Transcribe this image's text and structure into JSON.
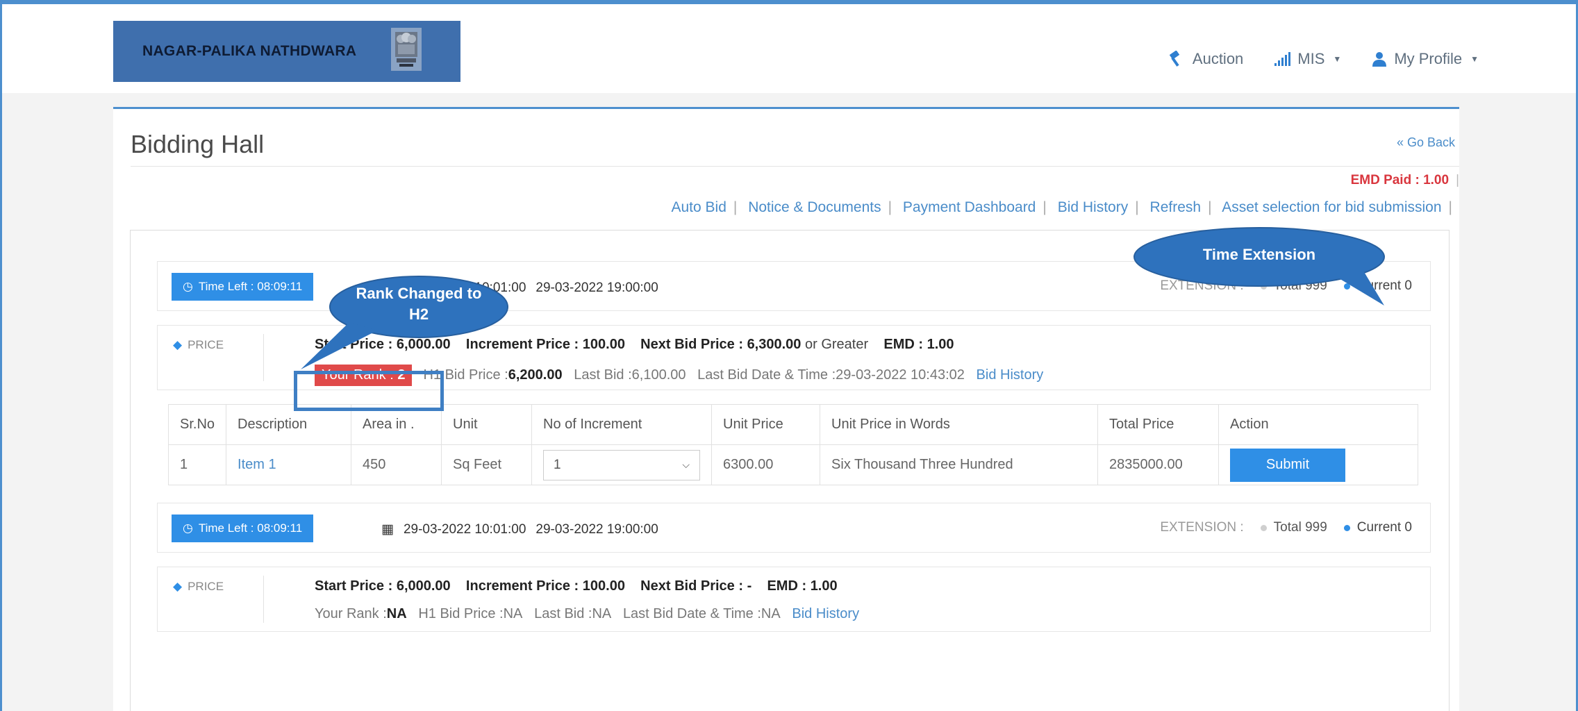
{
  "header": {
    "org_name": "NAGAR-PALIKA NATHDWARA",
    "nav": [
      {
        "label": "Auction",
        "icon": "gavel-icon"
      },
      {
        "label": "MIS",
        "icon": "bar-chart-icon"
      },
      {
        "label": "My Profile",
        "icon": "user-icon"
      }
    ]
  },
  "page": {
    "title": "Bidding Hall",
    "go_back": "« Go Back",
    "emd_paid": "EMD Paid : 1.00",
    "links": [
      "Auto Bid",
      "Notice & Documents",
      "Payment Dashboard",
      "Bid History",
      "Refresh",
      "Asset selection for bid submission"
    ]
  },
  "lots": [
    {
      "time_left": "Time Left : 08:09:11",
      "start_date": "29-03-2022 10:01:00",
      "end_date": "29-03-2022 19:00:00",
      "extension_label": "EXTENSION :",
      "total": "Total 999",
      "current": "Current 0",
      "price_label": "PRICE",
      "start_price_label": "Start Price : ",
      "start_price": "6,000.00",
      "increment_label": "Increment Price : ",
      "increment": "100.00",
      "next_bid_label": "Next Bid Price : ",
      "next_bid": "6,300.00",
      "next_bid_suffix": "or Greater",
      "emd_label": "EMD : ",
      "emd": "1.00",
      "rank_label": "Your Rank : ",
      "rank": "2",
      "h1_label": "H1 Bid Price : ",
      "h1": "6,200.00",
      "last_bid_label": "Last Bid : ",
      "last_bid": "6,100.00",
      "last_bid_date_label": "Last Bid Date & Time : ",
      "last_bid_date": "29-03-2022 10:43:02",
      "bid_history": "Bid History"
    },
    {
      "time_left": "Time Left : 08:09:11",
      "start_date": "29-03-2022 10:01:00",
      "end_date": "29-03-2022 19:00:00",
      "extension_label": "EXTENSION :",
      "total": "Total 999",
      "current": "Current 0",
      "price_label": "PRICE",
      "start_price_label": "Start Price : ",
      "start_price": "6,000.00",
      "increment_label": "Increment Price : ",
      "increment": "100.00",
      "next_bid_label": "Next Bid Price : ",
      "next_bid": "-",
      "emd_label": "EMD : ",
      "emd": "1.00",
      "rank_label": "Your Rank : ",
      "rank": "NA",
      "h1_label": "H1 Bid Price : ",
      "h1": "NA",
      "last_bid_label": "Last Bid : ",
      "last_bid": "NA",
      "last_bid_date_label": "Last Bid Date & Time : ",
      "last_bid_date": "NA",
      "bid_history": "Bid History"
    }
  ],
  "table": {
    "headers": [
      "Sr.No",
      "Description",
      "Area in .",
      "Unit",
      "No of Increment",
      "Unit Price",
      "Unit Price in Words",
      "Total Price",
      "Action"
    ],
    "rows": [
      {
        "sr": "1",
        "description": "Item 1",
        "area": "450",
        "unit": "Sq Feet",
        "increment": "1",
        "unit_price": "6300.00",
        "words": "Six Thousand Three Hundred",
        "total": "2835000.00",
        "action": "Submit"
      }
    ]
  },
  "annotations": {
    "time_extension": "Time Extension",
    "rank_changed_line1": "Rank Changed to",
    "rank_changed_line2": "H2"
  },
  "colors": {
    "brand_header": "#3f6fad",
    "accent_blue": "#2f8fe6",
    "rank_red": "#e04a4a",
    "callout_fill": "#2e72bd"
  }
}
